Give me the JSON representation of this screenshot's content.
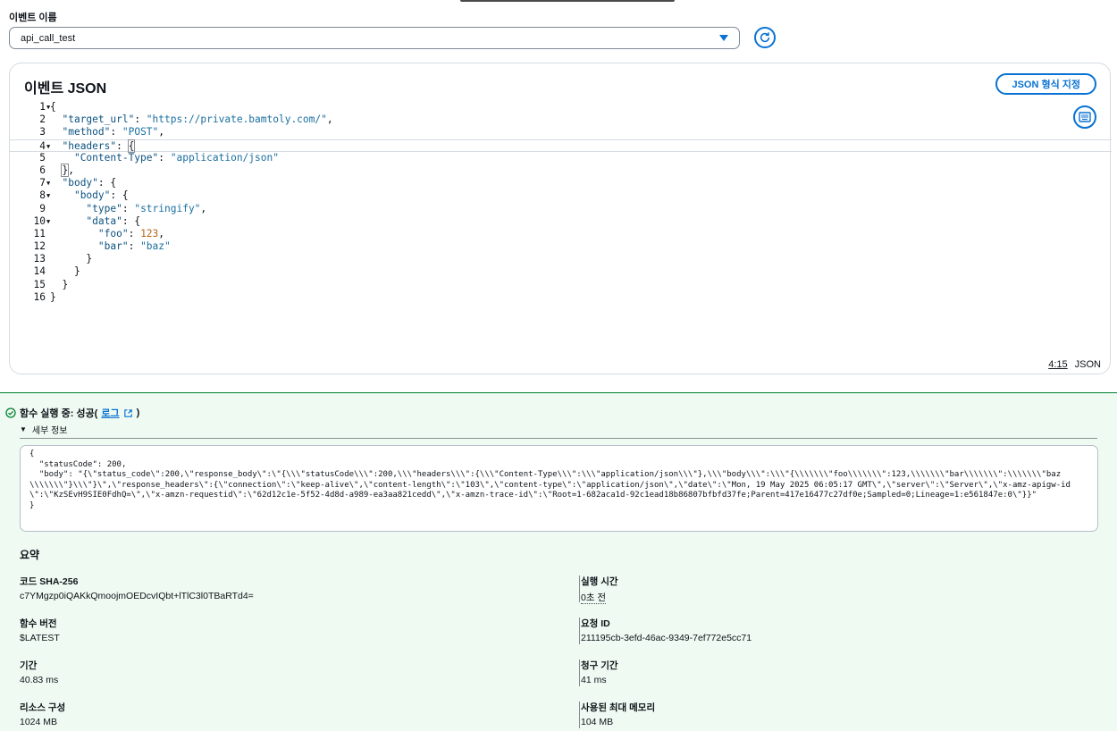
{
  "event_name": {
    "label": "이벤트 이름",
    "value": "api_call_test"
  },
  "editor": {
    "title": "이벤트 JSON",
    "format_button": "JSON 형식 지정",
    "cursor": "4:15",
    "language": "JSON",
    "lines": [
      {
        "n": "1",
        "fold": true,
        "html": "<span class=\"p\">{</span>"
      },
      {
        "n": "2",
        "fold": false,
        "html": "  <span class=\"k\">\"target_url\"</span><span class=\"p\">: </span><span class=\"str\">\"https://private.bamtoly.com/\"</span><span class=\"p\">,</span>"
      },
      {
        "n": "3",
        "fold": false,
        "html": "  <span class=\"k\">\"method\"</span><span class=\"p\">: </span><span class=\"str\">\"POST\"</span><span class=\"p\">,</span>"
      },
      {
        "n": "4",
        "fold": true,
        "active": true,
        "html": "  <span class=\"k\">\"headers\"</span><span class=\"p\">: </span><span class=\"p\" style=\"outline:1px solid #8c8c94\">{</span>"
      },
      {
        "n": "5",
        "fold": false,
        "html": "    <span class=\"k\">\"Content-Type\"</span><span class=\"p\">: </span><span class=\"str\">\"application/json\"</span>"
      },
      {
        "n": "6",
        "fold": false,
        "html": "  <span class=\"p\" style=\"outline:1px solid #8c8c94\">}</span><span class=\"p\">,</span>"
      },
      {
        "n": "7",
        "fold": true,
        "html": "  <span class=\"k\">\"body\"</span><span class=\"p\">: {</span>"
      },
      {
        "n": "8",
        "fold": true,
        "html": "    <span class=\"k\">\"body\"</span><span class=\"p\">: {</span>"
      },
      {
        "n": "9",
        "fold": false,
        "html": "      <span class=\"k\">\"type\"</span><span class=\"p\">: </span><span class=\"str\">\"stringify\"</span><span class=\"p\">,</span>"
      },
      {
        "n": "10",
        "fold": true,
        "html": "      <span class=\"k\">\"data\"</span><span class=\"p\">: {</span>"
      },
      {
        "n": "11",
        "fold": false,
        "html": "        <span class=\"k\">\"foo\"</span><span class=\"p\">: </span><span class=\"num\">123</span><span class=\"p\">,</span>"
      },
      {
        "n": "12",
        "fold": false,
        "html": "        <span class=\"k\">\"bar\"</span><span class=\"p\">: </span><span class=\"str\">\"baz\"</span>"
      },
      {
        "n": "13",
        "fold": false,
        "html": "      <span class=\"p\">}</span>"
      },
      {
        "n": "14",
        "fold": false,
        "html": "    <span class=\"p\">}</span>"
      },
      {
        "n": "15",
        "fold": false,
        "html": "  <span class=\"p\">}</span>"
      },
      {
        "n": "16",
        "fold": false,
        "html": "<span class=\"p\">}</span>"
      }
    ]
  },
  "result": {
    "heading_prefix": "함수 실행 중: 성공(",
    "log_link": "로그",
    "heading_suffix": ")",
    "details_label": "세부 정보",
    "output": "{\n  \"statusCode\": 200,\n  \"body\": \"{\\\"status_code\\\":200,\\\"response_body\\\":\\\"{\\\\\\\"statusCode\\\\\\\":200,\\\\\\\"headers\\\\\\\":{\\\\\\\"Content-Type\\\\\\\":\\\\\\\"application/json\\\\\\\"},\\\\\\\"body\\\\\\\":\\\\\\\"{\\\\\\\\\\\\\\\"foo\\\\\\\\\\\\\\\":123,\\\\\\\\\\\\\\\"bar\\\\\\\\\\\\\\\":\\\\\\\\\\\\\\\"baz\\\\\\\\\\\\\\\"}\\\\\\\"}\\\",\\\"response_headers\\\":{\\\"connection\\\":\\\"keep-alive\\\",\\\"content-length\\\":\\\"103\\\",\\\"content-type\\\":\\\"application/json\\\",\\\"date\\\":\\\"Mon, 19 May 2025 06:05:17 GMT\\\",\\\"server\\\":\\\"Server\\\",\\\"x-amz-apigw-id\\\":\\\"KzSEvH9SIE0FdhQ=\\\",\\\"x-amzn-requestid\\\":\\\"62d12c1e-5f52-4d8d-a989-ea3aa821cedd\\\",\\\"x-amzn-trace-id\\\":\\\"Root=1-682aca1d-92c1ead18b86807bfbfd37fe;Parent=417e16477c27df0e;Sampled=0;Lineage=1:e561847e:0\\\"}}\"\n}"
  },
  "summary": {
    "title": "요약",
    "items": [
      {
        "label": "코드 SHA-256",
        "value": "c7YMgzp0iQAKkQmoojmOEDcvIQbt+lTlC3l0TBaRTd4="
      },
      {
        "label": "실행 시간",
        "value": "0초 전"
      },
      {
        "label": "함수 버전",
        "value": "$LATEST"
      },
      {
        "label": "요청 ID",
        "value": "211195cb-3efd-46ac-9349-7ef772e5cc71"
      },
      {
        "label": "기간",
        "value": "40.83 ms"
      },
      {
        "label": "청구 기간",
        "value": "41 ms"
      },
      {
        "label": "리소스 구성",
        "value": "1024 MB"
      },
      {
        "label": "사용된 최대 메모리",
        "value": "104 MB"
      }
    ]
  }
}
